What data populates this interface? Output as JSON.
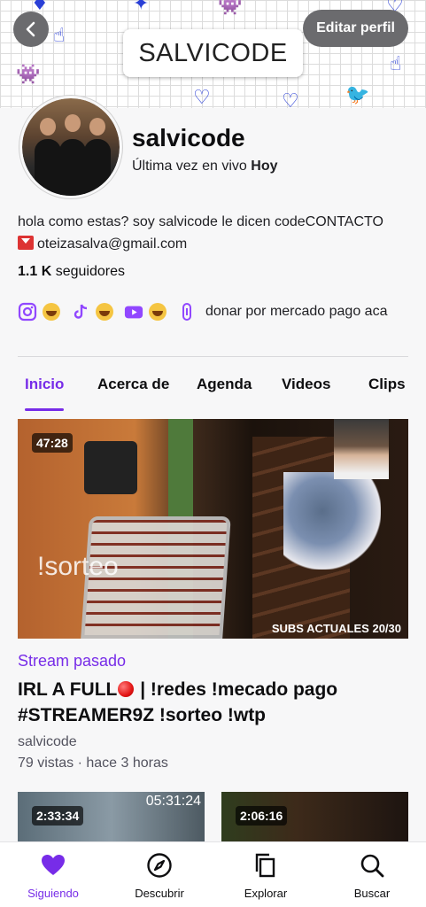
{
  "banner": {
    "title": "SALVICODE",
    "edit_label": "Editar perfil"
  },
  "profile": {
    "username": "salvicode",
    "last_live_prefix": "Última vez en vivo ",
    "last_live_value": "Hoy",
    "bio_line1": "hola como estas? soy salvicode le dicen codeCONTACTO",
    "bio_email": "oteizasalva@gmail.com",
    "followers_count": "1.1 K",
    "followers_label": " seguidores",
    "donate_text": "donar por mercado pago aca"
  },
  "tabs": [
    {
      "label": "Inicio",
      "active": true
    },
    {
      "label": "Acerca de",
      "active": false
    },
    {
      "label": "Agenda",
      "active": false
    },
    {
      "label": "Videos",
      "active": false
    },
    {
      "label": "Clips",
      "active": false
    }
  ],
  "featured": {
    "duration": "47:28",
    "overlay_text": "!sorteo",
    "subs_overlay": "SUBS ACTUALES 20/30",
    "label": "Stream pasado",
    "title_part1": "IRL A FULL",
    "title_part2": " | !redes !mecado pago #STREAMER9Z !sorteo !wtp",
    "channel": "salvicode",
    "meta": "79 vistas · hace 3 horas"
  },
  "more_videos": [
    {
      "duration": "2:33:34",
      "overlay": "05:31:24"
    },
    {
      "duration": "2:06:16",
      "overlay": ""
    }
  ],
  "bottom_nav": [
    {
      "label": "Siguiendo",
      "icon": "heart-icon",
      "active": true
    },
    {
      "label": "Descubrir",
      "icon": "compass-icon",
      "active": false
    },
    {
      "label": "Explorar",
      "icon": "copy-icon",
      "active": false
    },
    {
      "label": "Buscar",
      "icon": "search-icon",
      "active": false
    }
  ],
  "colors": {
    "accent": "#772ce8",
    "social_icon": "#9147ff",
    "record": "#e31515"
  }
}
